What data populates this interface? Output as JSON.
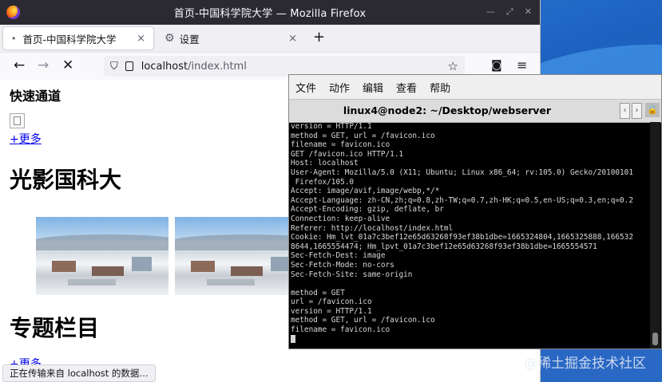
{
  "firefox": {
    "window_title": "首页-中国科学院大学 — Mozilla Firefox",
    "tabs": [
      {
        "label": "首页-中国科学院大学",
        "icon": "page-dot-icon"
      },
      {
        "label": "设置",
        "icon": "gear-icon"
      }
    ],
    "tab_close_glyph": "×",
    "new_tab_glyph": "+",
    "url_host": "localhost",
    "url_path": "/index.html",
    "status_text": "正在传输来自 localhost 的数据…"
  },
  "page": {
    "quick_heading": "快速通道",
    "more_link_1": "+更多",
    "photo_heading": "光影国科大",
    "topic_heading": "专题栏目",
    "more_link_2": "+更多"
  },
  "terminal": {
    "menu": [
      "文件",
      "动作",
      "编辑",
      "查看",
      "帮助"
    ],
    "title": "linux4@node2: ~/Desktop/webserver",
    "lines": [
      "version = HTTP/1.1",
      "method = GET, url = /favicon.ico",
      "filename = favicon.ico",
      "GET /favicon.ico HTTP/1.1",
      "Host: localhost",
      "User-Agent: Mozilla/5.0 (X11; Ubuntu; Linux x86_64; rv:105.0) Gecko/20100101",
      " Firefox/105.0",
      "Accept: image/avif,image/webp,*/*",
      "Accept-Language: zh-CN,zh;q=0.8,zh-TW;q=0.7,zh-HK;q=0.5,en-US;q=0.3,en;q=0.2",
      "Accept-Encoding: gzip, deflate, br",
      "Connection: keep-alive",
      "Referer: http://localhost/index.html",
      "Cookie: Hm_lvt_01a7c3bef12e65d63268f93ef38b1dbe=1665324804,1665325888,166532",
      "8644,1665554474; Hm_lpvt_01a7c3bef12e65d63268f93ef38b1dbe=1665554571",
      "Sec-Fetch-Dest: image",
      "Sec-Fetch-Mode: no-cors",
      "Sec-Fetch-Site: same-origin",
      "",
      "method = GET",
      "url = /favicon.ico",
      "version = HTTP/1.1",
      "method = GET, url = /favicon.ico",
      "filename = favicon.ico"
    ]
  },
  "watermark": "@稀土掘金技术社区"
}
